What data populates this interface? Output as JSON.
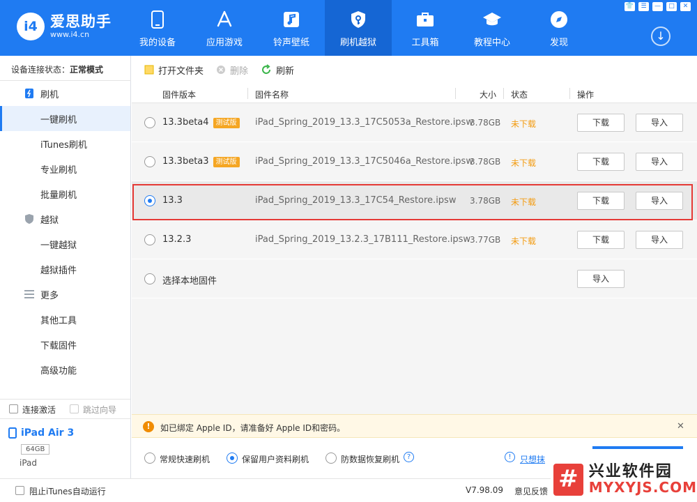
{
  "app": {
    "logo_mark": "i4",
    "name": "爱思助手",
    "url": "www.i4.cn"
  },
  "nav": [
    {
      "label": "我的设备",
      "icon": "phone-icon"
    },
    {
      "label": "应用游戏",
      "icon": "app-store-icon"
    },
    {
      "label": "铃声壁纸",
      "icon": "music-icon"
    },
    {
      "label": "刷机越狱",
      "icon": "key-shield-icon",
      "active": true
    },
    {
      "label": "工具箱",
      "icon": "toolbox-icon"
    },
    {
      "label": "教程中心",
      "icon": "graduation-cap-icon"
    },
    {
      "label": "发现",
      "icon": "compass-icon"
    }
  ],
  "window_buttons": {
    "shirt": "👕",
    "menu": "☰",
    "minimize": "—",
    "maximize": "□",
    "close": "✕"
  },
  "download_glyph": "↓",
  "sidebar": {
    "status_label": "设备连接状态：",
    "status_value": "正常模式",
    "groups": [
      {
        "label": "刷机",
        "icon": "flash-phone-icon",
        "items": [
          "一键刷机",
          "iTunes刷机",
          "专业刷机",
          "批量刷机"
        ]
      },
      {
        "label": "越狱",
        "icon": "shield-icon",
        "items": [
          "一键越狱",
          "越狱插件"
        ]
      },
      {
        "label": "更多",
        "icon": "list-icon",
        "items": [
          "其他工具",
          "下载固件",
          "高级功能"
        ]
      }
    ],
    "active_item": "一键刷机",
    "connect_activate": "连接激活",
    "skip_guide": "跳过向导",
    "device_name": "iPad Air 3",
    "device_storage": "64GB",
    "device_type": "iPad"
  },
  "toolbar": {
    "open_folder": "打开文件夹",
    "delete": "删除",
    "refresh": "刷新"
  },
  "table": {
    "headers": {
      "version": "固件版本",
      "name": "固件名称",
      "size": "大小",
      "status": "状态",
      "action": "操作"
    },
    "rows": [
      {
        "version": "13.3beta4",
        "badge": "测试版",
        "name": "iPad_Spring_2019_13.3_17C5053a_Restore.ipsw",
        "size": "3.78GB",
        "status": "未下载",
        "download": "下载",
        "import": "导入",
        "selected": false
      },
      {
        "version": "13.3beta3",
        "badge": "测试版",
        "name": "iPad_Spring_2019_13.3_17C5046a_Restore.ipsw",
        "size": "3.78GB",
        "status": "未下载",
        "download": "下载",
        "import": "导入",
        "selected": false
      },
      {
        "version": "13.3",
        "badge": "",
        "name": "iPad_Spring_2019_13.3_17C54_Restore.ipsw",
        "size": "3.78GB",
        "status": "未下载",
        "download": "下载",
        "import": "导入",
        "selected": true
      },
      {
        "version": "13.2.3",
        "badge": "",
        "name": "iPad_Spring_2019_13.2.3_17B111_Restore.ipsw",
        "size": "3.77GB",
        "status": "未下载",
        "download": "下载",
        "import": "导入",
        "selected": false
      }
    ],
    "local_label": "选择本地固件",
    "local_import": "导入"
  },
  "notice": {
    "text": "如已绑定 Apple ID，请准备好 Apple ID和密码。",
    "close": "✕"
  },
  "modes": {
    "quick": "常规快速刷机",
    "keep_data": "保留用户资料刷机",
    "anti_recovery": "防数据恢复刷机",
    "help": "?",
    "erase_link": "只想抹"
  },
  "footer": {
    "block_itunes": "阻止iTunes自动运行",
    "version": "V7.98.09",
    "feedback": "意见反馈"
  },
  "watermark": {
    "mark": "#",
    "title": "兴业软件园",
    "url": "MYXYJS.COM"
  }
}
